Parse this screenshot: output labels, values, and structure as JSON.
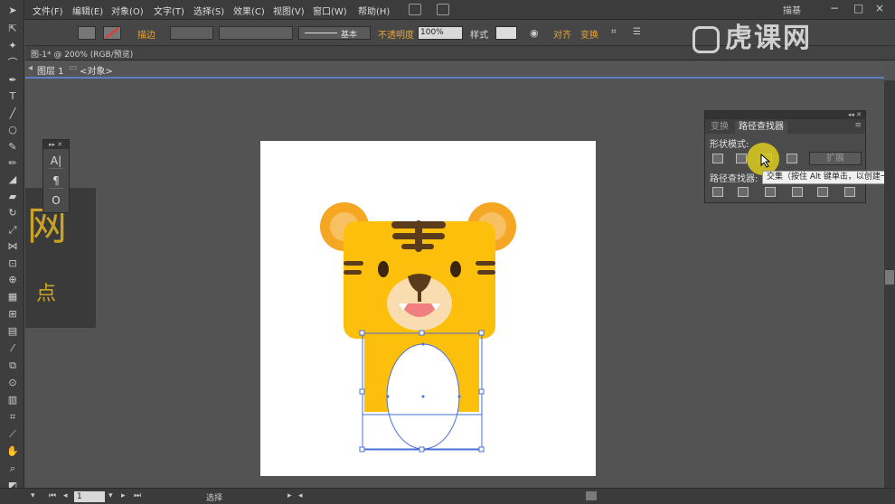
{
  "menu": {
    "items": [
      "文件(F)",
      "编辑(E)",
      "对象(O)",
      "文字(T)",
      "选择(S)",
      "效果(C)",
      "视图(V)",
      "窗口(W)",
      "帮助(H)"
    ],
    "workspace": "描基",
    "window_controls": [
      "−",
      "□",
      "×"
    ]
  },
  "control_bar": {
    "stroke_label": "描边",
    "stroke_style": "基本",
    "opacity_label": "不透明度",
    "opacity_value": "100%",
    "style_label": "样式",
    "align_label": "对齐",
    "transform_label": "变换"
  },
  "document": {
    "tab_title": "图-1* @ 200% (RGB/预览)",
    "breadcrumb_layer": "图层 1",
    "breadcrumb_object": "<对象>"
  },
  "character_panel": {
    "icons": [
      "A|",
      "¶",
      "O"
    ]
  },
  "left_graphic": {
    "char1": "网",
    "char2": "点"
  },
  "pathfinder": {
    "tab_transform": "变换",
    "tab_pathfinder": "路径查找器",
    "shape_modes_label": "形状模式:",
    "pathfinders_label": "路径查找器:",
    "expand_label": "扩展"
  },
  "tooltip": "交集（按住 Alt 键单击，以创建一个",
  "status": {
    "zoom": "1",
    "tool": "选择"
  },
  "watermark": "虎课网",
  "colors": {
    "tiger_orange": "#fcbf0b",
    "ear_outer": "#f5a623",
    "ear_inner": "#f7c063",
    "stripe": "#5a3b1c",
    "muzzle": "#f9ddb1",
    "mouth": "#f27f7f",
    "selection": "#4a6fd6",
    "accent": "#e8a53a"
  }
}
